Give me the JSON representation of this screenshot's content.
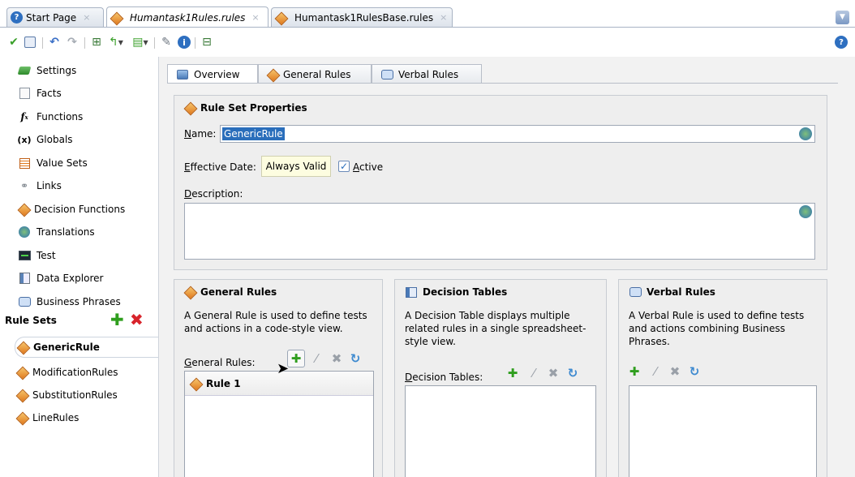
{
  "tabs": [
    {
      "label": "Start Page",
      "icon": "help-circle-icon"
    },
    {
      "label": "Humantask1Rules.rules",
      "icon": "rules-diamond-icon"
    },
    {
      "label": "Humantask1RulesBase.rules",
      "icon": "rules-diamond-icon"
    }
  ],
  "tab_close": "×",
  "sidebar": {
    "items": [
      {
        "label": "Settings",
        "icon": "settings-icon"
      },
      {
        "label": "Facts",
        "icon": "facts-icon"
      },
      {
        "label": "Functions",
        "icon": "functions-icon"
      },
      {
        "label": "Globals",
        "icon": "globals-icon"
      },
      {
        "label": "Value Sets",
        "icon": "value-sets-icon"
      },
      {
        "label": "Links",
        "icon": "links-icon"
      },
      {
        "label": "Decision Functions",
        "icon": "decision-functions-icon"
      },
      {
        "label": "Translations",
        "icon": "translations-icon"
      },
      {
        "label": "Test",
        "icon": "test-icon"
      },
      {
        "label": "Data Explorer",
        "icon": "data-explorer-icon"
      },
      {
        "label": "Business Phrases",
        "icon": "business-phrases-icon"
      }
    ],
    "rule_sets_label": "Rule Sets",
    "rule_sets": [
      {
        "label": "GenericRule",
        "selected": true
      },
      {
        "label": "ModificationRules",
        "selected": false
      },
      {
        "label": "SubstitutionRules",
        "selected": false
      },
      {
        "label": "LineRules",
        "selected": false
      }
    ]
  },
  "subtabs": [
    {
      "label": "Overview",
      "icon": "overview-icon"
    },
    {
      "label": "General Rules",
      "icon": "rules-diamond-icon"
    },
    {
      "label": "Verbal Rules",
      "icon": "verbal-rules-icon"
    }
  ],
  "properties": {
    "title": "Rule Set Properties",
    "name_label_u": "N",
    "name_label_rest": "ame:",
    "name_value": "GenericRule",
    "effective_label_u": "E",
    "effective_label_rest": "ffective Date:",
    "effective_value": "Always Valid",
    "active_label_u": "A",
    "active_label_rest": "ctive",
    "active_checked": true,
    "description_label_u": "D",
    "description_label_rest": "escription:",
    "description_value": ""
  },
  "general_rules": {
    "title": "General Rules",
    "desc": "A General Rule is used to define tests and actions in a code-style view.",
    "list_label_u": "G",
    "list_label_rest": "eneral Rules:",
    "rows": [
      "Rule 1"
    ]
  },
  "decision_tables": {
    "title": "Decision Tables",
    "desc": "A Decision Table displays multiple related rules in a single spreadsheet-style view.",
    "list_label_u": "D",
    "list_label_rest": "ecision Tables:"
  },
  "verbal_rules": {
    "title": "Verbal Rules",
    "desc": "A Verbal Rule is used to define tests and actions combining Business Phrases."
  },
  "colors": {
    "accent": "#2a6ebb",
    "tab_border": "#a9b4c4",
    "panel_bg": "#eeeeee",
    "add_green": "#2f9e1e",
    "delete_red": "#d8242b",
    "date_bg": "#fdfde0"
  }
}
